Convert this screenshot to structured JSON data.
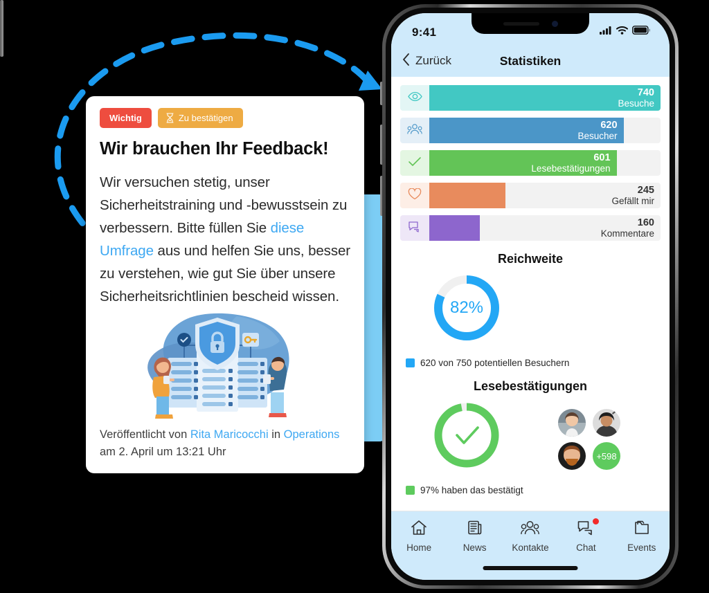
{
  "post_card": {
    "badges": [
      {
        "label": "Wichtig",
        "color": "#ee4d3f",
        "icon": "none"
      },
      {
        "label": "Zu bestätigen",
        "color": "#eeab43",
        "icon": "hourglass-icon"
      }
    ],
    "title": "Wir brauchen Ihr Feedback!",
    "body_part1": "Wir versuchen stetig, unser Sicherheitstraining und -bewusstsein zu verbessern. Bitte füllen Sie ",
    "body_link": "diese Umfrage",
    "body_part2": " aus und helfen Sie uns, besser zu verstehen, wie gut Sie über unsere Sicherheitsrichtlinien bescheid wissen.",
    "illustration": "data-security-servers-shield-lock-illustration",
    "footer_prefix": "Veröffentlicht von ",
    "footer_author": "Rita Maricocchi",
    "footer_middle": " in ",
    "footer_channel": "Operations",
    "footer_date": "am 2. April um 13:21 Uhr",
    "link_color": "#3ea8f2"
  },
  "phone": {
    "status_bar": {
      "time": "9:41",
      "icons": [
        "signal-icon",
        "wifi-icon",
        "battery-icon"
      ]
    },
    "nav": {
      "back_label": "Zurück",
      "back_icon": "chevron-left-icon",
      "title": "Statistiken"
    },
    "stat_bars": [
      {
        "icon": "eye-icon",
        "value": "740",
        "label": "Besuche",
        "color": "#42c8c3",
        "icon_bg": "#e3f6f5",
        "icon_color": "#42c8c3",
        "pct": 100,
        "text_inside": true
      },
      {
        "icon": "visitors-icon",
        "value": "620",
        "label": "Besucher",
        "color": "#4b96c8",
        "icon_bg": "#e4eff7",
        "icon_color": "#4b96c8",
        "pct": 84,
        "text_inside": true
      },
      {
        "icon": "check-icon",
        "value": "601",
        "label": "Lesebestätigungen",
        "color": "#63c457",
        "icon_bg": "#e4f6e2",
        "icon_color": "#63c457",
        "pct": 81,
        "text_inside": true
      },
      {
        "icon": "heart-icon",
        "value": "245",
        "label": "Gefällt mir",
        "color": "#e88b5d",
        "icon_bg": "#fdeee6",
        "icon_color": "#e88b5d",
        "pct": 33,
        "text_inside": false
      },
      {
        "icon": "comment-icon",
        "value": "160",
        "label": "Kommentare",
        "color": "#8d66cd",
        "icon_bg": "#eee7f7",
        "icon_color": "#8d66cd",
        "pct": 22,
        "text_inside": false
      }
    ],
    "reach": {
      "title": "Reichweite",
      "percent_label": "82%",
      "percent_value": 82,
      "color": "#23a7f5",
      "track_color": "#f0f0f0",
      "legend": "620 von 750 potentiellen Besuchern"
    },
    "read_receipts": {
      "title": "Lesebestätigungen",
      "percent_value": 97,
      "color": "#5ecb5e",
      "track_color": "#f0f0f0",
      "center_icon": "check-icon",
      "legend": "97% haben das bestätigt",
      "avatars": [
        "avatar-woman-1",
        "avatar-woman-2",
        "avatar-man-1"
      ],
      "avatar_overflow": "+598"
    },
    "tabs": [
      {
        "label": "Home",
        "icon": "home-icon",
        "badge": false
      },
      {
        "label": "News",
        "icon": "news-icon",
        "badge": false
      },
      {
        "label": "Kontakte",
        "icon": "contacts-icon",
        "badge": false
      },
      {
        "label": "Chat",
        "icon": "chat-icon",
        "badge": true
      },
      {
        "label": "Events",
        "icon": "events-icon",
        "badge": false
      }
    ]
  },
  "decor": {
    "arrow": "dashed-curved-arrow",
    "arrow_color": "#1b9bf0",
    "background_color": "#000000",
    "blue_panel_color": "#7ccdf5"
  },
  "chart_data": {
    "type": "bar",
    "title": "Statistiken",
    "categories": [
      "Besuche",
      "Besucher",
      "Lesebestätigungen",
      "Gefällt mir",
      "Kommentare"
    ],
    "values": [
      740,
      620,
      601,
      245,
      160
    ],
    "colors": [
      "#42c8c3",
      "#4b96c8",
      "#63c457",
      "#e88b5d",
      "#8d66cd"
    ],
    "xlabel": "",
    "ylabel": "",
    "ylim": [
      0,
      740
    ],
    "grid": false,
    "legend": "none",
    "extra_donuts": [
      {
        "title": "Reichweite",
        "value": 82,
        "unit": "%",
        "note": "620 von 750 potentiellen Besuchern",
        "color": "#23a7f5"
      },
      {
        "title": "Lesebestätigungen",
        "value": 97,
        "unit": "%",
        "note": "97% haben das bestätigt",
        "color": "#5ecb5e"
      }
    ]
  }
}
